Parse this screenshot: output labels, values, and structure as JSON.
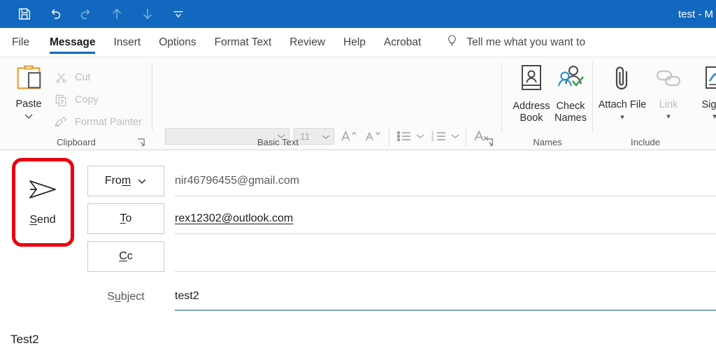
{
  "window": {
    "title": "test  -  M",
    "accent_color": "#1168be",
    "annotation_color": "#e8000d"
  },
  "quick_access": {
    "items": [
      {
        "name": "save-icon",
        "label": "Save",
        "enabled": true
      },
      {
        "name": "undo-icon",
        "label": "Undo",
        "enabled": true
      },
      {
        "name": "redo-icon",
        "label": "Redo",
        "enabled": false
      },
      {
        "name": "move-up-icon",
        "label": "Move Up",
        "enabled": false
      },
      {
        "name": "move-down-icon",
        "label": "Move Down",
        "enabled": false
      },
      {
        "name": "chevron-down-icon",
        "label": "Customize Quick Access Toolbar",
        "enabled": true
      }
    ]
  },
  "ribbon_tabs": {
    "items": [
      {
        "label": "File",
        "active": false
      },
      {
        "label": "Message",
        "active": true
      },
      {
        "label": "Insert",
        "active": false
      },
      {
        "label": "Options",
        "active": false
      },
      {
        "label": "Format Text",
        "active": false
      },
      {
        "label": "Review",
        "active": false
      },
      {
        "label": "Help",
        "active": false
      },
      {
        "label": "Acrobat",
        "active": false
      }
    ],
    "tell_me": "Tell me what you want to"
  },
  "ribbon": {
    "clipboard": {
      "group_label": "Clipboard",
      "paste_label": "Paste",
      "items": [
        {
          "label": "Cut",
          "icon": "scissors-icon",
          "enabled": false
        },
        {
          "label": "Copy",
          "icon": "copy-icon",
          "enabled": false
        },
        {
          "label": "Format Painter",
          "icon": "format-painter-icon",
          "enabled": false
        }
      ]
    },
    "basic_text": {
      "group_label": "Basic Text",
      "font_name": "",
      "font_size": "11",
      "buttons": [
        "bold-button",
        "italic-button",
        "underline-button",
        "text-highlight-color-button",
        "font-color-button",
        "grow-font-button",
        "shrink-font-button",
        "bullets-button",
        "numbering-button",
        "clear-formatting-button",
        "align-left-button",
        "align-center-button",
        "align-right-button",
        "decrease-indent-button",
        "increase-indent-button",
        "ltr-text-direction-button",
        "rtl-text-direction-button"
      ]
    },
    "names": {
      "group_label": "Names",
      "items": [
        {
          "label": "Address Book",
          "icon": "address-book-icon",
          "enabled": true
        },
        {
          "label": "Check Names",
          "icon": "check-names-icon",
          "enabled": true
        }
      ]
    },
    "include": {
      "group_label": "Include",
      "items": [
        {
          "label": "Attach File",
          "icon": "paperclip-icon",
          "enabled": true,
          "has_dropdown": true
        },
        {
          "label": "Link",
          "icon": "link-icon",
          "enabled": false,
          "has_dropdown": true
        },
        {
          "label": "Signa",
          "icon": "signature-icon",
          "enabled": true,
          "has_dropdown": true
        }
      ]
    }
  },
  "compose": {
    "send_button": "Send",
    "send_icon": "paper-plane-icon",
    "from": {
      "button_label": "From",
      "value": "nir46796455@gmail.com",
      "has_dropdown": true
    },
    "to": {
      "button_label": "To",
      "value": "rex12302@outlook.com"
    },
    "cc": {
      "button_label": "Cc",
      "value": ""
    },
    "subject": {
      "label": "Subject",
      "value": "test2"
    },
    "body": "Test2"
  }
}
